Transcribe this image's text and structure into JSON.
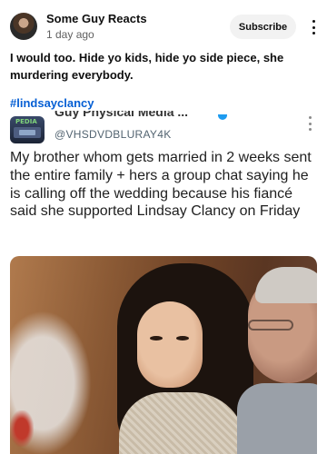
{
  "post": {
    "channel_name": "Some Guy Reacts",
    "time": "1 day ago",
    "subscribe_label": "Subscribe",
    "text": "I would too. Hide yo kids, hide yo side piece, she murdering everybody.",
    "hashtag": "#lindsayclancy"
  },
  "embed": {
    "name": "Guy Physical Media ...",
    "handle": "@VHSDVDBLURAY4K",
    "body": "My brother whom gets married in 2 weeks sent the entire family + hers a group chat saying he is calling off the wedding because his fiancé said she supported Lindsay Clancy on Friday"
  },
  "icons": {
    "more": "more-vert-icon",
    "verified": "verified-badge-icon"
  }
}
